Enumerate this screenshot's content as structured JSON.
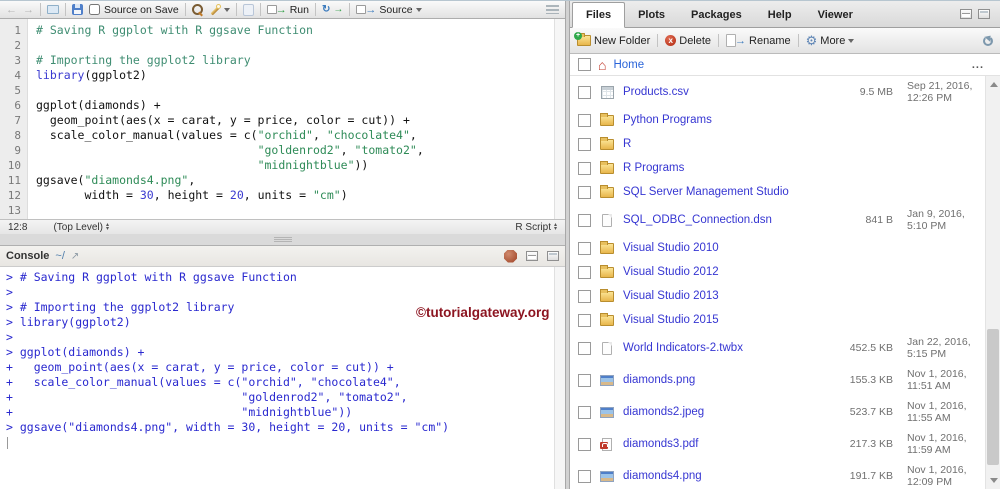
{
  "editor": {
    "toolbar": {
      "source_on_save": "Source on Save",
      "run_label": "Run",
      "source_label": "Source"
    },
    "lines": [
      {
        "n": "1",
        "seg": [
          [
            "c",
            "# Saving R ggplot with R ggsave Function"
          ]
        ]
      },
      {
        "n": "2",
        "seg": []
      },
      {
        "n": "3",
        "seg": [
          [
            "c",
            "# Importing the ggplot2 library"
          ]
        ]
      },
      {
        "n": "4",
        "seg": [
          [
            "k",
            "library"
          ],
          [
            "p",
            "(ggplot2)"
          ]
        ]
      },
      {
        "n": "5",
        "seg": []
      },
      {
        "n": "6",
        "seg": [
          [
            "p",
            "ggplot(diamonds) +"
          ]
        ]
      },
      {
        "n": "7",
        "seg": [
          [
            "p",
            "  geom_point(aes(x = carat, y = price, color = cut)) +"
          ]
        ]
      },
      {
        "n": "8",
        "seg": [
          [
            "p",
            "  scale_color_manual(values = c("
          ],
          [
            "s",
            "\"orchid\""
          ],
          [
            "p",
            ", "
          ],
          [
            "s",
            "\"chocolate4\""
          ],
          [
            "p",
            ","
          ]
        ]
      },
      {
        "n": "9",
        "seg": [
          [
            "p",
            "                                "
          ],
          [
            "s",
            "\"goldenrod2\""
          ],
          [
            "p",
            ", "
          ],
          [
            "s",
            "\"tomato2\""
          ],
          [
            "p",
            ","
          ]
        ]
      },
      {
        "n": "10",
        "seg": [
          [
            "p",
            "                                "
          ],
          [
            "s",
            "\"midnightblue\""
          ],
          [
            "p",
            "))"
          ]
        ]
      },
      {
        "n": "11",
        "seg": [
          [
            "p",
            "ggsave("
          ],
          [
            "s",
            "\"diamonds4.png\""
          ],
          [
            "p",
            ","
          ]
        ]
      },
      {
        "n": "12",
        "seg": [
          [
            "p",
            "       width = "
          ],
          [
            "k",
            "30"
          ],
          [
            "p",
            ", height = "
          ],
          [
            "k",
            "20"
          ],
          [
            "p",
            ", units = "
          ],
          [
            "s",
            "\"cm\""
          ],
          [
            "p",
            ")"
          ]
        ]
      },
      {
        "n": "13",
        "seg": []
      }
    ],
    "status": {
      "cursor_position": "12:8",
      "scope": "(Top Level)",
      "file_type": "R Script"
    }
  },
  "console": {
    "title": "Console",
    "working_dir": "~/",
    "lines": [
      "> # Saving R ggplot with R ggsave Function",
      "> ",
      "> # Importing the ggplot2 library",
      "> library(ggplot2)",
      "> ",
      "> ggplot(diamonds) +",
      "+   geom_point(aes(x = carat, y = price, color = cut)) +",
      "+   scale_color_manual(values = c(\"orchid\", \"chocolate4\",",
      "+                                 \"goldenrod2\", \"tomato2\",",
      "+                                 \"midnightblue\"))",
      "> ggsave(\"diamonds4.png\", width = 30, height = 20, units = \"cm\")"
    ],
    "watermark": "©tutorialgateway.org"
  },
  "files_pane": {
    "tabs": [
      "Files",
      "Plots",
      "Packages",
      "Help",
      "Viewer"
    ],
    "toolbar": {
      "new_folder": "New Folder",
      "delete": "Delete",
      "rename": "Rename",
      "more": "More"
    },
    "breadcrumb": {
      "home": "Home",
      "ellipsis": "..."
    },
    "rows": [
      {
        "name": "Products.csv",
        "type": "csv",
        "size": "9.5 MB",
        "date": "Sep 21, 2016, 12:26 PM"
      },
      {
        "name": "Python Programs",
        "type": "folder",
        "size": "",
        "date": ""
      },
      {
        "name": "R",
        "type": "folder",
        "size": "",
        "date": ""
      },
      {
        "name": "R Programs",
        "type": "folder",
        "size": "",
        "date": ""
      },
      {
        "name": "SQL Server Management Studio",
        "type": "folder",
        "size": "",
        "date": ""
      },
      {
        "name": "SQL_ODBC_Connection.dsn",
        "type": "file",
        "size": "841 B",
        "date": "Jan 9, 2016, 5:10 PM"
      },
      {
        "name": "Visual Studio 2010",
        "type": "folder",
        "size": "",
        "date": ""
      },
      {
        "name": "Visual Studio 2012",
        "type": "folder",
        "size": "",
        "date": ""
      },
      {
        "name": "Visual Studio 2013",
        "type": "folder",
        "size": "",
        "date": ""
      },
      {
        "name": "Visual Studio 2015",
        "type": "folder",
        "size": "",
        "date": ""
      },
      {
        "name": "World Indicators-2.twbx",
        "type": "file",
        "size": "452.5 KB",
        "date": "Jan 22, 2016, 5:15 PM"
      },
      {
        "name": "diamonds.png",
        "type": "image",
        "size": "155.3 KB",
        "date": "Nov 1, 2016, 11:51 AM"
      },
      {
        "name": "diamonds2.jpeg",
        "type": "image",
        "size": "523.7 KB",
        "date": "Nov 1, 2016, 11:55 AM"
      },
      {
        "name": "diamonds3.pdf",
        "type": "pdf",
        "size": "217.3 KB",
        "date": "Nov 1, 2016, 11:59 AM"
      },
      {
        "name": "diamonds4.png",
        "type": "image",
        "size": "191.7 KB",
        "date": "Nov 1, 2016, 12:09 PM"
      }
    ]
  },
  "colors": {
    "syntax_comment": "#3f8d72",
    "syntax_string": "#2e8b57",
    "syntax_keyword": "#3a3ad0",
    "console_text": "#2a29cf",
    "file_link": "#3636d2",
    "watermark": "#8c1420",
    "folder_yellow": "#e8b64c"
  }
}
